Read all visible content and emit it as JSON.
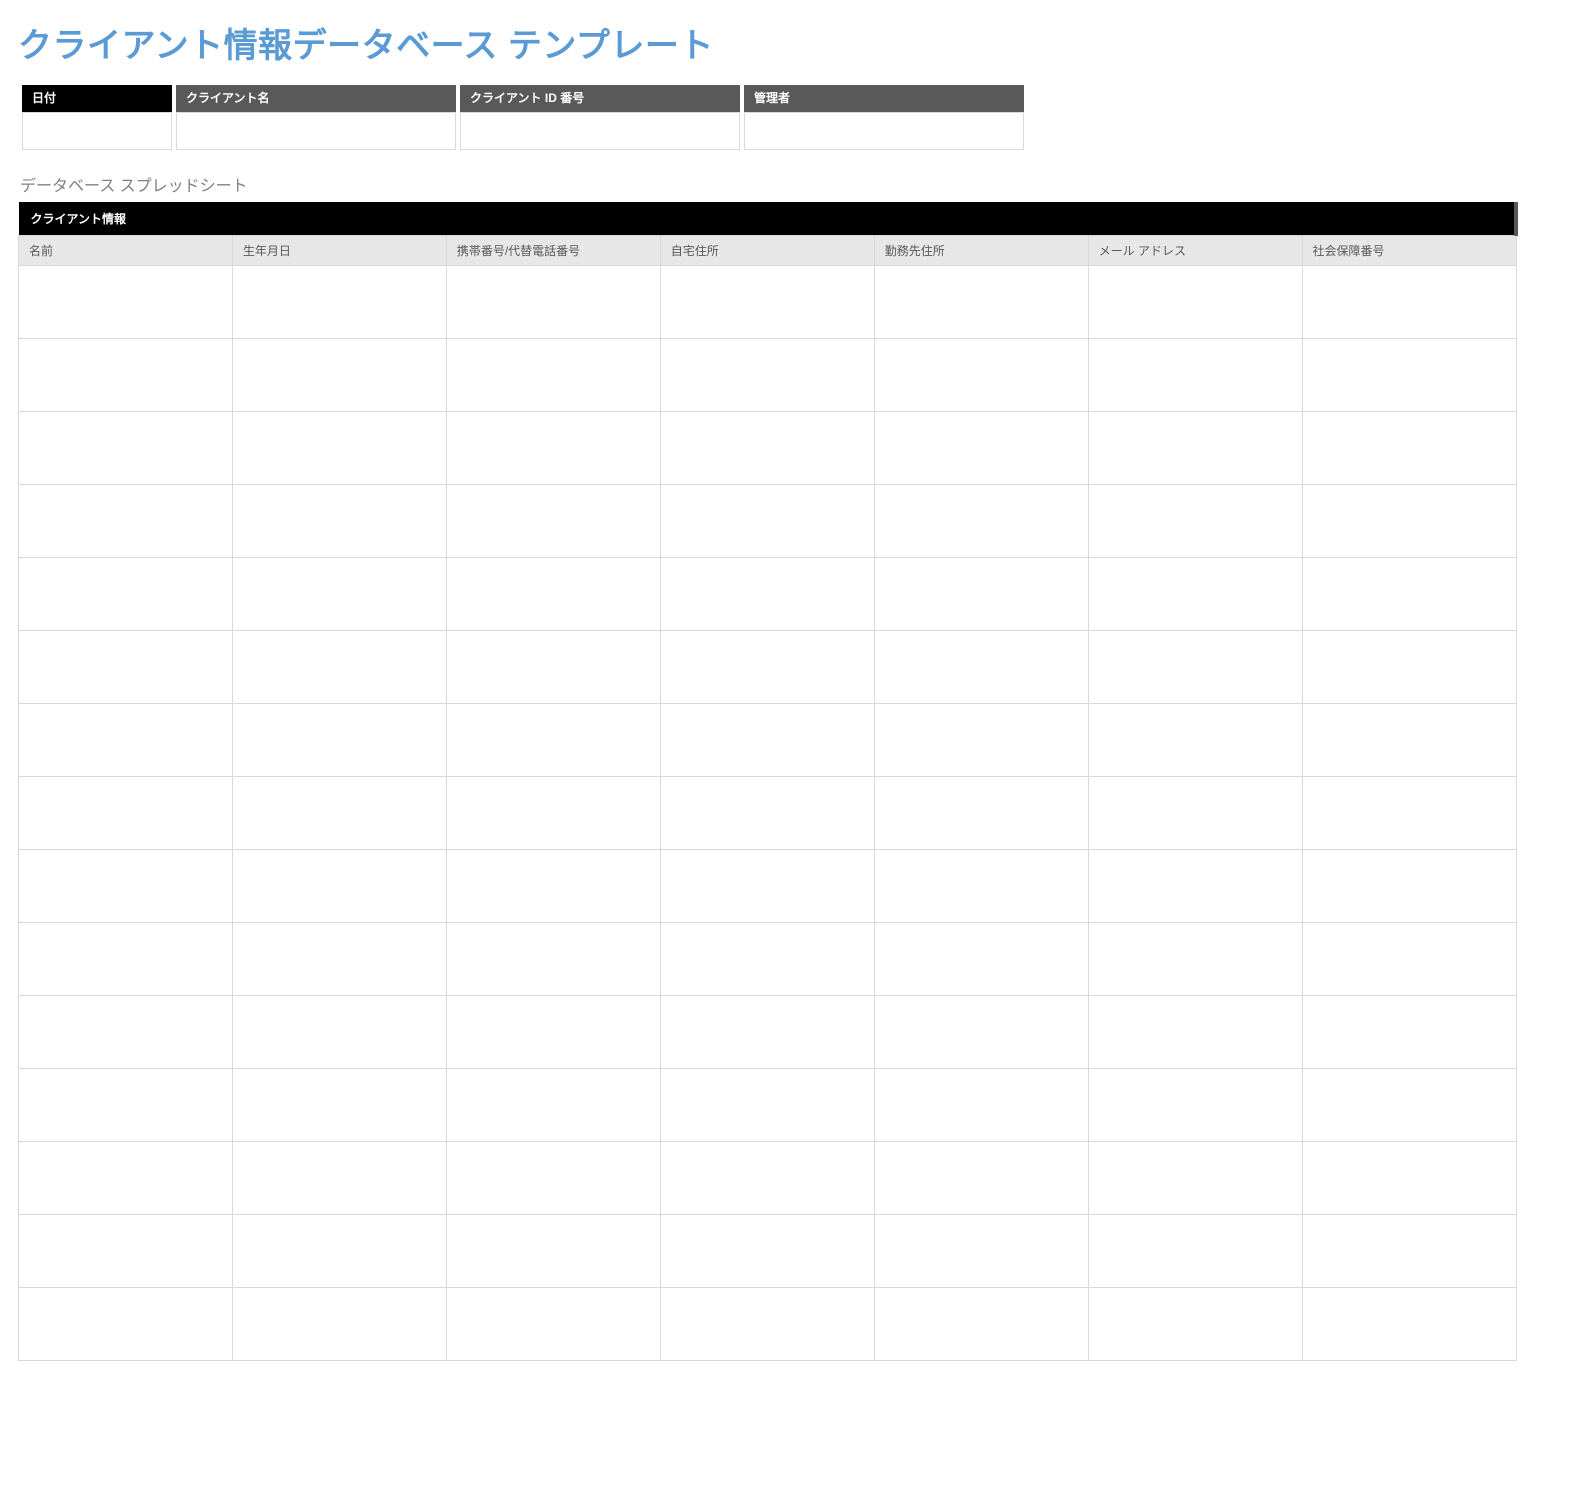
{
  "title": "クライアント情報データベース テンプレート",
  "summary": {
    "headers": {
      "date": "日付",
      "client": "クライアント名",
      "id": "クライアント ID 番号",
      "admin": "管理者"
    },
    "values": {
      "date": "",
      "client": "",
      "id": "",
      "admin": ""
    }
  },
  "subtitle": "データベース スプレッドシート",
  "db": {
    "section_title": "クライアント情報",
    "columns": {
      "name": "名前",
      "dob": "生年月日",
      "phone": "携帯番号/代替電話番号",
      "home": "自宅住所",
      "work": "勤務先住所",
      "email": "メール アドレス",
      "ssn": "社会保障番号"
    },
    "row_count": 15
  }
}
